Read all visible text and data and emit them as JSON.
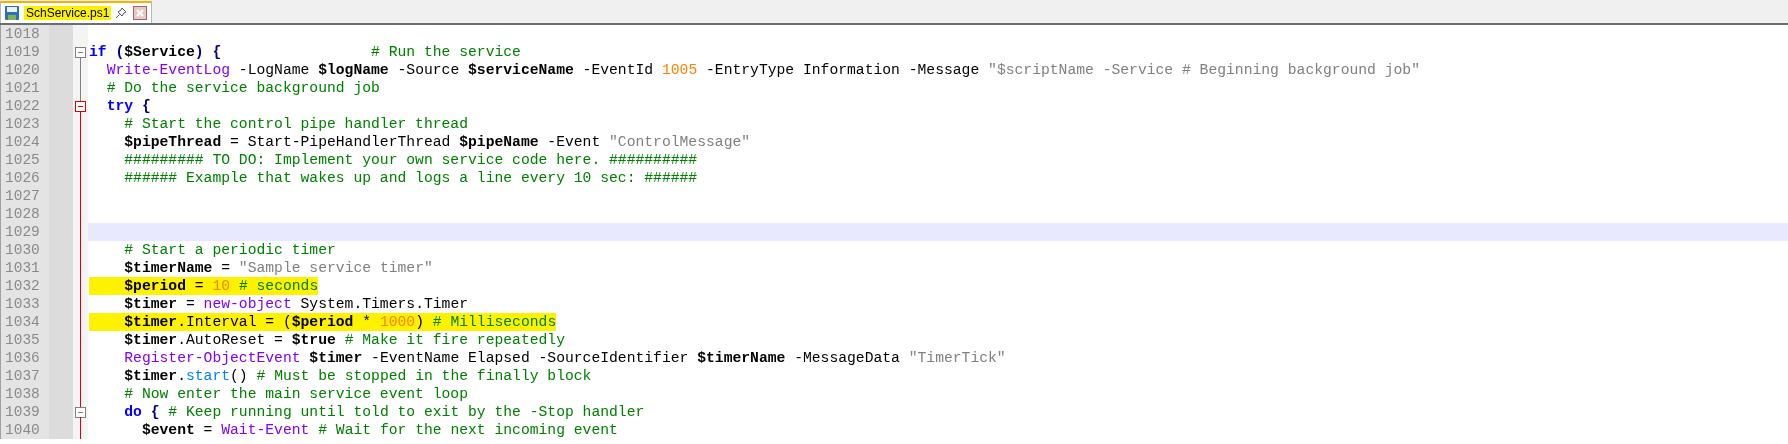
{
  "tab": {
    "title": "SchService.ps1",
    "marker": true,
    "selected": true
  },
  "lines": [
    {
      "number": "1018"
    },
    {
      "number": "1019",
      "fold_open": true,
      "fold_active": false,
      "tokens": [
        {
          "kind": "keyword",
          "text": "if"
        },
        {
          "kind": "operator",
          "text": " ("
        },
        {
          "kind": "variable",
          "text": "$Service"
        },
        {
          "kind": "operator",
          "text": ") {"
        },
        {
          "kind": "comment",
          "text": "                 # Run the service"
        }
      ]
    },
    {
      "number": "1020",
      "tokens": [
        {
          "kind": "cmdlet",
          "text": "  Write-EventLog"
        },
        {
          "kind": "plain",
          "text": " -LogName "
        },
        {
          "kind": "variable",
          "text": "$logName"
        },
        {
          "kind": "plain",
          "text": " -Source "
        },
        {
          "kind": "variable",
          "text": "$serviceName"
        },
        {
          "kind": "plain",
          "text": " -EventId "
        },
        {
          "kind": "number",
          "text": "1005"
        },
        {
          "kind": "plain",
          "text": " -EntryType Information -Message "
        },
        {
          "kind": "string",
          "text": "\"$scriptName -Service # Beginning background job\""
        }
      ]
    },
    {
      "number": "1021",
      "tokens": [
        {
          "kind": "comment",
          "text": "  # Do the service background job"
        }
      ]
    },
    {
      "number": "1022",
      "fold_open": true,
      "fold_active": true,
      "tokens": [
        {
          "kind": "keyword",
          "text": "  try"
        },
        {
          "kind": "operator",
          "text": " {"
        }
      ]
    },
    {
      "number": "1023",
      "tokens": [
        {
          "kind": "comment",
          "text": "    # Start the control pipe handler thread"
        }
      ]
    },
    {
      "number": "1024",
      "tokens": [
        {
          "kind": "variable",
          "text": "    $pipeThread"
        },
        {
          "kind": "plain",
          "text": " = Start-PipeHandlerThread "
        },
        {
          "kind": "variable",
          "text": "$pipeName"
        },
        {
          "kind": "plain",
          "text": " -Event "
        },
        {
          "kind": "string",
          "text": "\"ControlMessage\""
        }
      ]
    },
    {
      "number": "1025",
      "tokens": [
        {
          "kind": "comment",
          "text": "    ######### TO DO: Implement your own service code here. ##########"
        }
      ]
    },
    {
      "number": "1026",
      "tokens": [
        {
          "kind": "comment",
          "text": "    ###### Example that wakes up and logs a line every 10 sec: ######"
        }
      ]
    },
    {
      "number": "1027"
    },
    {
      "number": "1028"
    },
    {
      "number": "1029",
      "current": true
    },
    {
      "number": "1030",
      "tokens": [
        {
          "kind": "comment",
          "text": "    # Start a periodic timer"
        }
      ]
    },
    {
      "number": "1031",
      "tokens": [
        {
          "kind": "variable",
          "text": "    $timerName"
        },
        {
          "kind": "plain",
          "text": " = "
        },
        {
          "kind": "string",
          "text": "\"Sample service timer\""
        }
      ]
    },
    {
      "number": "1032",
      "marker": true,
      "tokens": [
        {
          "kind": "variable",
          "text": "    $period"
        },
        {
          "kind": "plain",
          "text": " = "
        },
        {
          "kind": "number",
          "text": "10"
        },
        {
          "kind": "comment",
          "text": " # seconds"
        }
      ]
    },
    {
      "number": "1033",
      "tokens": [
        {
          "kind": "variable",
          "text": "    $timer"
        },
        {
          "kind": "plain",
          "text": " = "
        },
        {
          "kind": "cmdlet",
          "text": "new-object"
        },
        {
          "kind": "plain",
          "text": " System.Timers.Timer"
        }
      ]
    },
    {
      "number": "1034",
      "marker": true,
      "tokens": [
        {
          "kind": "variable",
          "text": "    $timer"
        },
        {
          "kind": "plain",
          "text": ".Interval = ("
        },
        {
          "kind": "variable",
          "text": "$period"
        },
        {
          "kind": "plain",
          "text": " * "
        },
        {
          "kind": "number",
          "text": "1000"
        },
        {
          "kind": "plain",
          "text": ") "
        },
        {
          "kind": "comment",
          "text": "# Milliseconds"
        }
      ]
    },
    {
      "number": "1035",
      "tokens": [
        {
          "kind": "variable",
          "text": "    $timer"
        },
        {
          "kind": "plain",
          "text": ".AutoReset = "
        },
        {
          "kind": "variable",
          "text": "$true"
        },
        {
          "kind": "comment",
          "text": " # Make it fire repeatedly"
        }
      ]
    },
    {
      "number": "1036",
      "tokens": [
        {
          "kind": "cmdlet",
          "text": "    Register-ObjectEvent"
        },
        {
          "kind": "variable",
          "text": " $timer"
        },
        {
          "kind": "plain",
          "text": " -EventName Elapsed -SourceIdentifier "
        },
        {
          "kind": "variable",
          "text": "$timerName"
        },
        {
          "kind": "plain",
          "text": " -MessageData "
        },
        {
          "kind": "string",
          "text": "\"TimerTick\""
        }
      ]
    },
    {
      "number": "1037",
      "tokens": [
        {
          "kind": "variable",
          "text": "    $timer"
        },
        {
          "kind": "plain",
          "text": "."
        },
        {
          "kind": "method",
          "text": "start"
        },
        {
          "kind": "plain",
          "text": "()"
        },
        {
          "kind": "comment",
          "text": " # Must be stopped in the finally block"
        }
      ]
    },
    {
      "number": "1038",
      "tokens": [
        {
          "kind": "comment",
          "text": "    # Now enter the main service event loop"
        }
      ]
    },
    {
      "number": "1039",
      "fold_open": true,
      "fold_active": false,
      "tokens": [
        {
          "kind": "keyword",
          "text": "    do"
        },
        {
          "kind": "operator",
          "text": " { "
        },
        {
          "kind": "comment",
          "text": "# Keep running until told to exit by the -Stop handler"
        }
      ]
    },
    {
      "number": "1040",
      "tokens": [
        {
          "kind": "variable",
          "text": "      $event"
        },
        {
          "kind": "plain",
          "text": " = "
        },
        {
          "kind": "cmdlet",
          "text": "Wait-Event"
        },
        {
          "kind": "comment",
          "text": " # Wait for the next incoming event"
        }
      ]
    }
  ]
}
